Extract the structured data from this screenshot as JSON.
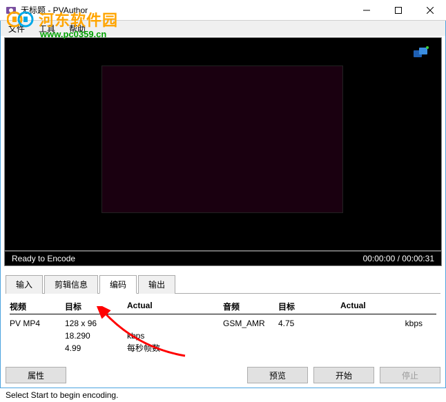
{
  "window": {
    "title": "无标题 - PVAuthor"
  },
  "menu": {
    "file": "文件",
    "tools": "工具",
    "help": "帮助"
  },
  "watermark": {
    "text": "河东软件园",
    "url": "www.pc0359.cn"
  },
  "status": {
    "ready": "Ready to Encode",
    "time": "00:00:00 / 00:00:31"
  },
  "tabs": {
    "input": "输入",
    "clip": "剪辑信息",
    "encode": "编码",
    "output": "输出"
  },
  "panel": {
    "video_hdr": "视频",
    "target_hdr": "目标",
    "actual_hdr": "Actual",
    "audio_hdr": "音频",
    "video_codec": "PV MP4",
    "video_dim": "128 x 96",
    "video_bitrate": "18.290",
    "video_fps": "4.99",
    "kbps": "kbps",
    "fps_label": "每秒帧数",
    "audio_codec": "GSM_AMR",
    "audio_bitrate": "4.75"
  },
  "buttons": {
    "properties": "属性",
    "preview": "预览",
    "start": "开始",
    "stop": "停止"
  },
  "footer": {
    "hint": "Select Start to begin encoding."
  }
}
